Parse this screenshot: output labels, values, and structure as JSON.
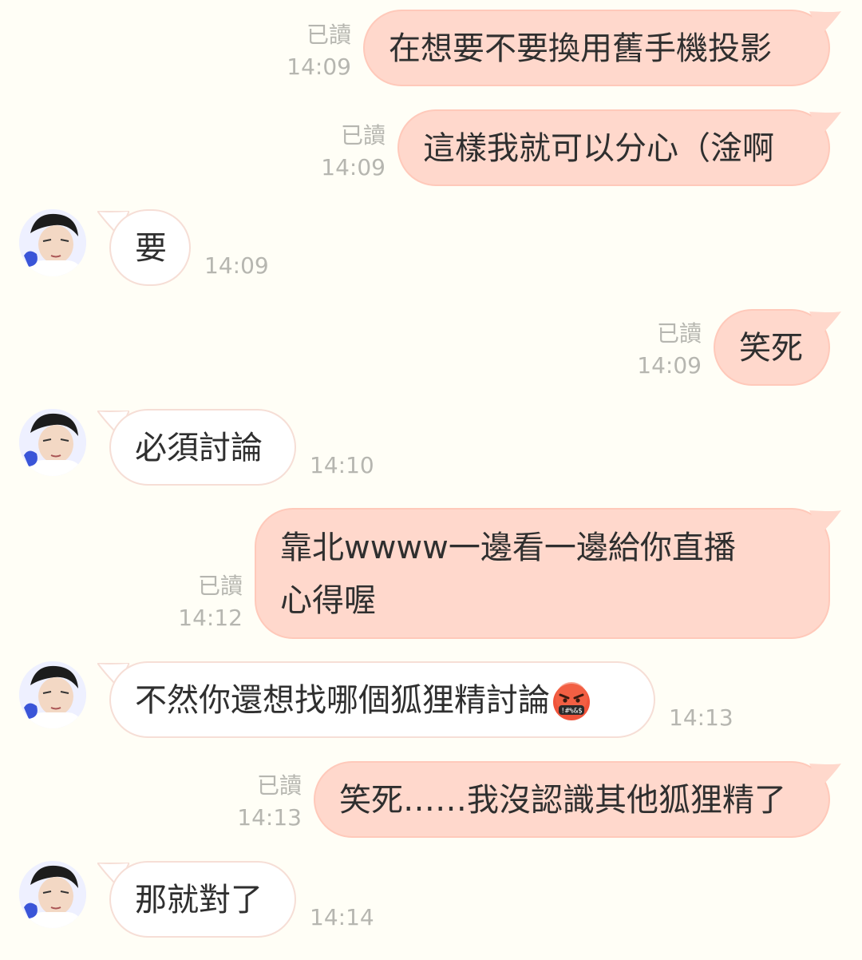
{
  "messages": [
    {
      "dir": "out",
      "text": "在想要不要換用舊手機投影",
      "read": "已讀",
      "time": "14:09"
    },
    {
      "dir": "out",
      "text": "這樣我就可以分心（淦啊",
      "read": "已讀",
      "time": "14:09"
    },
    {
      "dir": "in",
      "text": "要",
      "time": "14:09"
    },
    {
      "dir": "out",
      "text": "笑死",
      "read": "已讀",
      "time": "14:09"
    },
    {
      "dir": "in",
      "text": "必須討論",
      "time": "14:10"
    },
    {
      "dir": "out",
      "line1": "靠北wwww一邊看一邊給你直播",
      "line2": "心得喔",
      "read": "已讀",
      "time": "14:12"
    },
    {
      "dir": "in",
      "text": "不然你還想找哪個狐狸精討論",
      "emoji": "face-with-symbols-on-mouth",
      "time": "14:13"
    },
    {
      "dir": "out",
      "text": "笑死……我沒認識其他狐狸精了",
      "read": "已讀",
      "time": "14:13"
    },
    {
      "dir": "in",
      "text": "那就對了",
      "time": "14:14"
    }
  ],
  "colors": {
    "background": "#fffef6",
    "outgoing_bubble": "#ffd8cc",
    "incoming_bubble": "#ffffff",
    "meta_text": "#b6b6b0"
  }
}
